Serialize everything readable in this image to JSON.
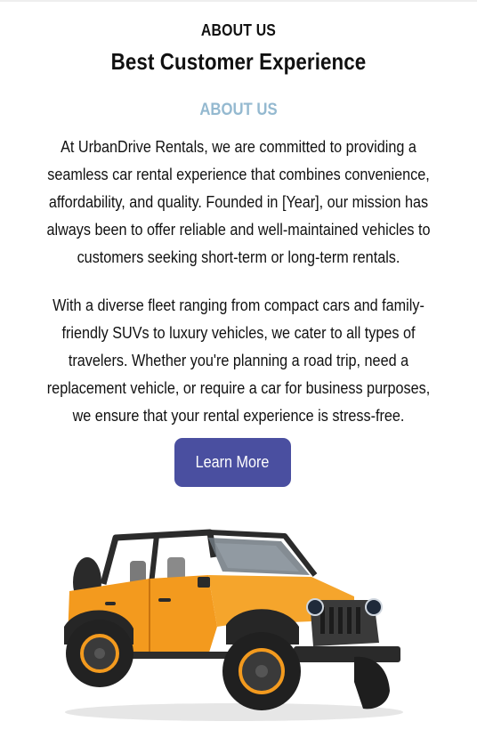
{
  "about": {
    "eyebrow": "ABOUT US",
    "headline": "Best Customer Experience",
    "section_label": "ABOUT US",
    "paragraphs": [
      "At UrbanDrive Rentals, we are committed to providing a seamless car rental experience that combines convenience, affordability, and quality. Founded in [Year], our mission has always been to offer reliable and well-maintained vehicles to customers seeking short-term or long-term rentals.",
      "With a diverse fleet ranging from compact cars and family-friendly SUVs to luxury vehicles, we cater to all types of travelers. Whether you're planning a road trip, need a replacement vehicle, or require a car for business purposes, we ensure that your rental experience is stress-free."
    ],
    "cta_label": "Learn More"
  },
  "colors": {
    "section_label": "#94b9d0",
    "button_bg": "#4a4fa0",
    "car_body": "#f39a1e",
    "text": "#111111"
  },
  "image": {
    "subject": "orange-off-road-suv"
  }
}
